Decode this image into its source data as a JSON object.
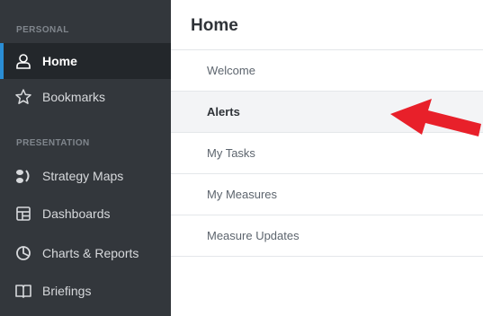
{
  "sidebar": {
    "sections": [
      {
        "label": "PERSONAL",
        "items": [
          {
            "label": "Home",
            "icon": "user-icon",
            "active": true
          },
          {
            "label": "Bookmarks",
            "icon": "star-icon",
            "active": false
          }
        ]
      },
      {
        "label": "PRESENTATION",
        "items": [
          {
            "label": "Strategy Maps",
            "icon": "strategy-map-icon",
            "active": false
          },
          {
            "label": "Dashboards",
            "icon": "dashboard-icon",
            "active": false
          },
          {
            "label": "Charts & Reports",
            "icon": "pie-chart-icon",
            "active": false
          },
          {
            "label": "Briefings",
            "icon": "book-icon",
            "active": false
          }
        ]
      }
    ]
  },
  "main": {
    "title": "Home",
    "items": [
      {
        "label": "Welcome",
        "active": false
      },
      {
        "label": "Alerts",
        "active": true
      },
      {
        "label": "My Tasks",
        "active": false
      },
      {
        "label": "My Measures",
        "active": false
      },
      {
        "label": "Measure Updates",
        "active": false
      }
    ]
  },
  "annotation": {
    "icon": "red-arrow-icon",
    "color": "#e8202a"
  },
  "colors": {
    "sidebar_bg": "#33373c",
    "active_accent": "#2a8dd4"
  }
}
